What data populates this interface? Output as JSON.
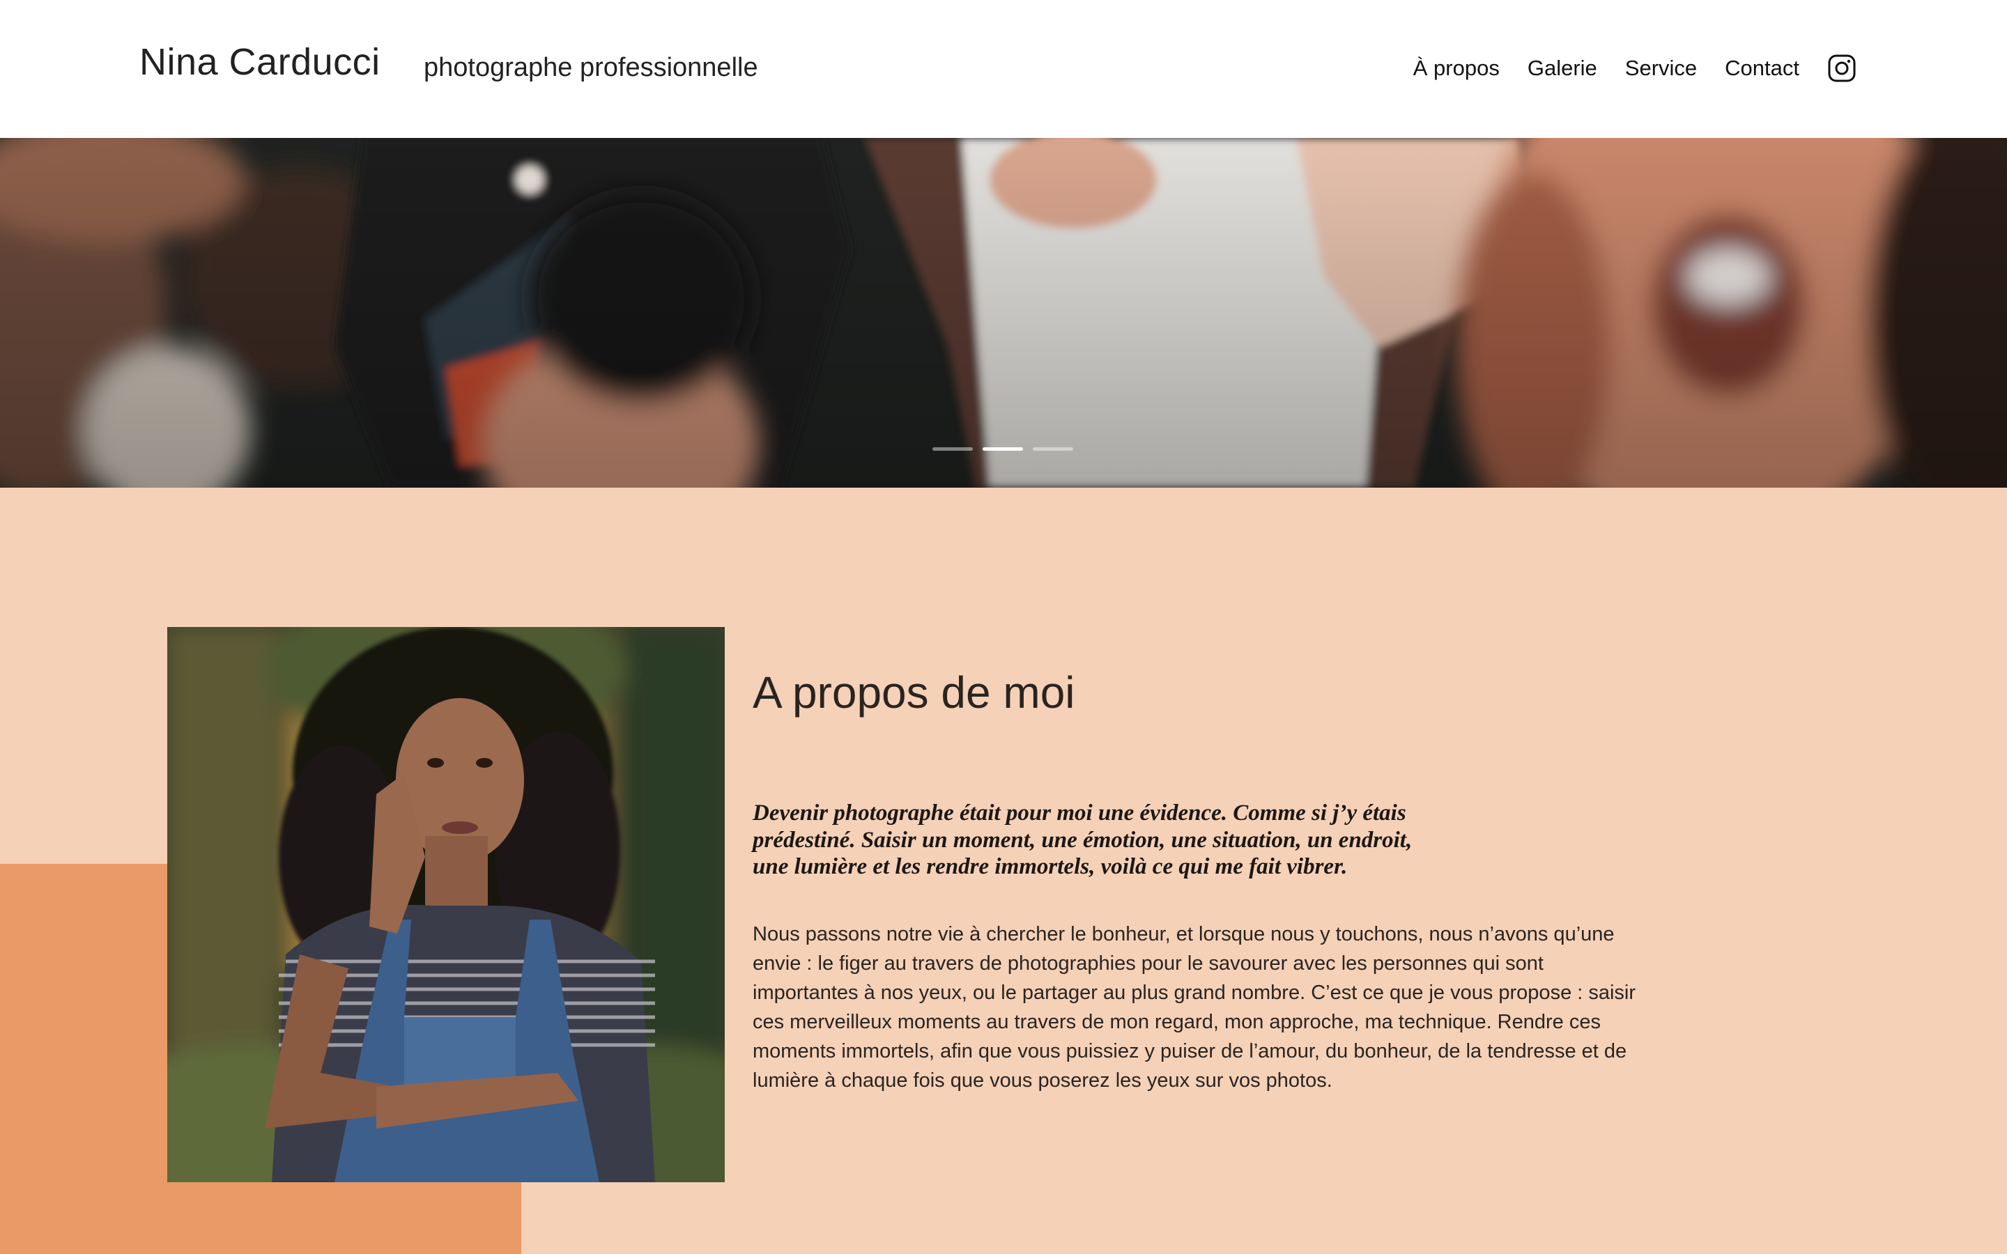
{
  "header": {
    "brand": "Nina Carducci",
    "tagline": "photographe professionnelle",
    "nav": {
      "about": "À propos",
      "gallery": "Galerie",
      "service": "Service",
      "contact": "Contact"
    },
    "social_icon": "instagram-icon"
  },
  "hero": {
    "slides_count": 3,
    "active_slide": 2
  },
  "about": {
    "title": "A propos de moi",
    "quote": "Devenir photographe était pour moi une évidence. Comme si j’y étais prédestiné. Saisir un moment, une émotion, une situation, un endroit, une lumière et les rendre immortels, voilà ce qui me fait vibrer.",
    "body": "Nous passons notre vie à chercher le bonheur, et lorsque nous y touchons, nous n’avons qu’une envie : le figer au travers de photographies pour le savourer avec les personnes qui sont importantes à nos yeux, ou le partager au plus grand nombre. C’est ce que je vous propose : saisir ces merveilleux moments au travers de mon regard, mon approche, ma technique. Rendre ces moments immortels, afin que vous puissiez y puiser de l’amour, du bonheur, de la tendresse et de lumière à chaque fois que vous poserez les yeux sur vos photos."
  },
  "colors": {
    "page_background": "#f5d1b8",
    "accent_block": "#ea9a66",
    "header_background": "#ffffff",
    "text": "#1f1b19"
  }
}
